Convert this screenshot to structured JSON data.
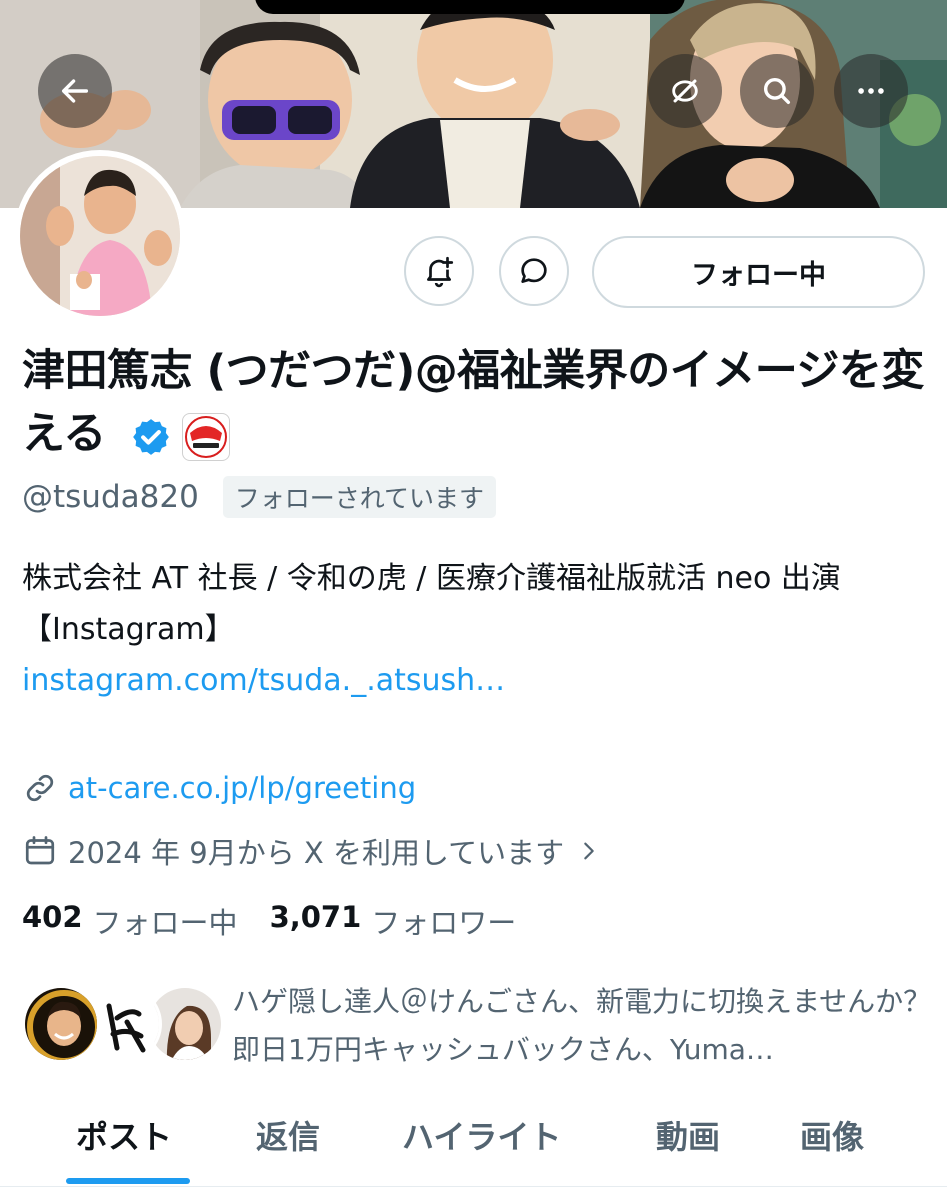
{
  "header": {
    "back_icon": "arrow-left-icon",
    "right_icons": [
      "translate-off-icon",
      "search-icon",
      "more-icon"
    ]
  },
  "profile": {
    "display_name": "津田篤志 (つだつだ)@福祉業界のイメージを変える",
    "handle": "@tsuda820",
    "follows_you": "フォローされています",
    "follow_button": "フォロー中",
    "affiliate_badge_text": "令和の虎"
  },
  "bio": {
    "line1": "株式会社 AT 社長 / 令和の虎 / 医療介護福祉版就活 neo 出演",
    "line2": "【Instagram】",
    "instagram_link": "instagram.com/tsuda._.atsush…",
    "website": "at-care.co.jp/lp/greeting",
    "joined": "2024 年 9月から X を利用しています"
  },
  "stats": {
    "following_count": "402",
    "following_label": "フォロー中",
    "followers_count": "3,071",
    "followers_label": "フォロワー"
  },
  "followers_you_know": "ハゲ隠し達人＠けんごさん、新電力に切換えませんか？即日1万円キャッシュバックさん、Yuma…",
  "tabs": [
    {
      "label": "ポスト",
      "active": true
    },
    {
      "label": "返信",
      "active": false
    },
    {
      "label": "ハイライト",
      "active": false
    },
    {
      "label": "動画",
      "active": false
    },
    {
      "label": "画像",
      "active": false
    }
  ],
  "colors": {
    "link": "#1d9bf0",
    "secondary_text": "#536471",
    "primary_text": "#0f1419",
    "verified": "#1d9bf0"
  }
}
